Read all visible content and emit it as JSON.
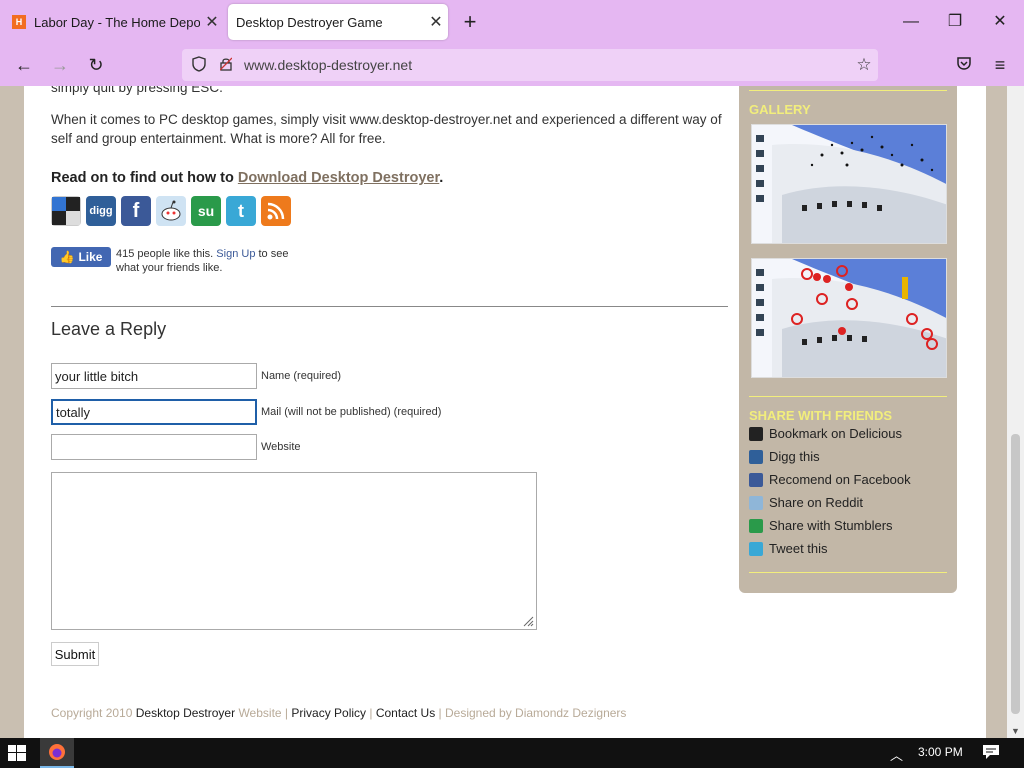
{
  "browser": {
    "tabs": [
      {
        "title": "Labor Day - The Home Depot",
        "favicon": "home-depot-icon"
      },
      {
        "title": "Desktop Destroyer Game",
        "favicon": "none",
        "active": true
      }
    ],
    "url": "www.desktop-destroyer.net"
  },
  "article": {
    "cut_text": "simply quit by pressing ESC.",
    "free_paragraph": "When it comes to PC desktop games, simply visit www.desktop-destroyer.net and experienced a different way of self and group entertainment. What is more? All for free.",
    "read_on_prefix": "Read on to find out how to ",
    "read_on_link": "Download Desktop Destroyer",
    "read_on_suffix": "."
  },
  "social_icons": [
    {
      "name": "delicious-icon",
      "label": "",
      "color": "#222222"
    },
    {
      "name": "digg-icon",
      "label": "digg",
      "color": "#2f5f99"
    },
    {
      "name": "facebook-icon",
      "label": "f",
      "color": "#3b5998"
    },
    {
      "name": "reddit-icon",
      "label": "",
      "color": "#8fb6d8"
    },
    {
      "name": "stumbleupon-icon",
      "label": "su",
      "color": "#2a9a4a"
    },
    {
      "name": "twitter-icon",
      "label": "t",
      "color": "#39a8d6"
    },
    {
      "name": "rss-icon",
      "label": "",
      "color": "#ee7a1c"
    }
  ],
  "fb_like": {
    "button": "Like",
    "text_prefix": "415 people like this. ",
    "signup": "Sign Up",
    "text_suffix": " to see what your friends like."
  },
  "reply": {
    "title": "Leave a Reply",
    "name_value": "your little bitch",
    "name_label": "Name (required)",
    "mail_value": "totally",
    "mail_label": "Mail (will not be published) (required)",
    "website_value": "",
    "website_label": "Website",
    "submit": "Submit"
  },
  "footer": {
    "copyright": "Copyright 2010 ",
    "site_name": "Desktop Destroyer",
    "website": " Website | ",
    "privacy": "Privacy Policy",
    "sep": " | ",
    "contact": "Contact Us",
    "designed": " | Designed by Diamondz Dezigners"
  },
  "sidebar": {
    "gallery_heading": "GALLERY",
    "share_heading": "SHARE WITH FRIENDS",
    "share_items": [
      {
        "label": "Bookmark on Delicious",
        "icon": "delicious-icon",
        "color": "#222222"
      },
      {
        "label": "Digg this",
        "icon": "digg-icon",
        "color": "#2f5f99"
      },
      {
        "label": "Recomend on Facebook",
        "icon": "facebook-icon",
        "color": "#3b5998"
      },
      {
        "label": "Share on Reddit",
        "icon": "reddit-icon",
        "color": "#8fb6d8"
      },
      {
        "label": "Share with Stumblers",
        "icon": "stumbleupon-icon",
        "color": "#2a9a4a"
      },
      {
        "label": "Tweet this",
        "icon": "twitter-icon",
        "color": "#39a8d6"
      }
    ]
  },
  "taskbar": {
    "time": "3:00 PM"
  }
}
